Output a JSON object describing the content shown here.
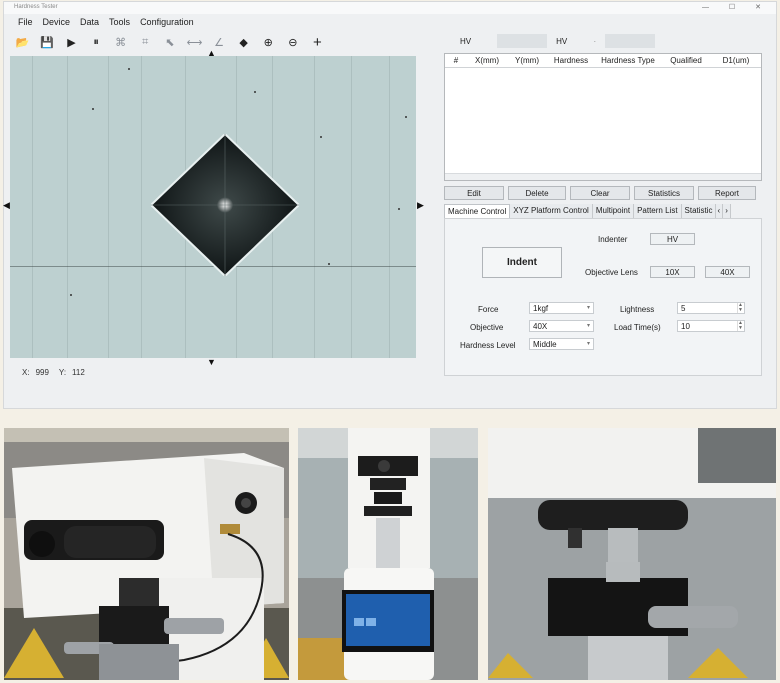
{
  "app": {
    "title": "Hardness Tester",
    "window_controls": "— ☐ ✕"
  },
  "menu": [
    "File",
    "Device",
    "Data",
    "Tools",
    "Configuration"
  ],
  "toolbar": [
    {
      "name": "open-folder-icon",
      "glyph": "📂"
    },
    {
      "name": "save-icon",
      "glyph": "💾"
    },
    {
      "name": "play-icon",
      "glyph": "▶"
    },
    {
      "name": "pause-icon",
      "glyph": "⏸"
    },
    {
      "name": "auto-measure-icon",
      "glyph": "⌘"
    },
    {
      "name": "crop-icon",
      "glyph": "⌗"
    },
    {
      "name": "select-pointer-icon",
      "glyph": "⬉"
    },
    {
      "name": "horizontal-measure-icon",
      "glyph": "⟷"
    },
    {
      "name": "angle-measure-icon",
      "glyph": "∠"
    },
    {
      "name": "eraser-icon",
      "glyph": "◆"
    },
    {
      "name": "zoom-in-icon",
      "glyph": "⊕"
    },
    {
      "name": "zoom-out-icon",
      "glyph": "⊖"
    },
    {
      "name": "crosshair-icon",
      "glyph": "+"
    }
  ],
  "status": {
    "x_label": "X:",
    "x_value": "999",
    "y_label": "Y:",
    "y_value": "112"
  },
  "header": {
    "hv_label": "HV",
    "hv_combo": "HV",
    "combo_arrow": "·"
  },
  "table": {
    "columns": [
      "#",
      "X(mm)",
      "Y(mm)",
      "Hardness",
      "Hardness Type",
      "Qualified",
      "D1(um)"
    ]
  },
  "buttons": [
    "Edit",
    "Delete",
    "Clear",
    "Statistics",
    "Report"
  ],
  "tabs": [
    "Machine Control",
    "XYZ Platform Control",
    "Multipoint",
    "Pattern List",
    "Statistic"
  ],
  "tab_scroll": [
    "‹",
    "›"
  ],
  "machine_control": {
    "indent_label": "Indent",
    "indenter_label": "Indenter",
    "indenter_value": "HV",
    "objective_lens_label": "Objective Lens",
    "lens_10x": "10X",
    "lens_40x": "40X",
    "force_label": "Force",
    "force_value": "1kgf",
    "objective_label": "Objective",
    "objective_value": "40X",
    "hardness_level_label": "Hardness Level",
    "hardness_level_value": "Middle",
    "lightness_label": "Lightness",
    "lightness_value": "5",
    "load_time_label": "Load Time(s)",
    "load_time_value": "10"
  },
  "colors": {
    "viewport": "#bdd0d0",
    "indent": "#0f1416",
    "screen_bg": "#eef0f2",
    "machine_white": "#f4f4f2"
  }
}
